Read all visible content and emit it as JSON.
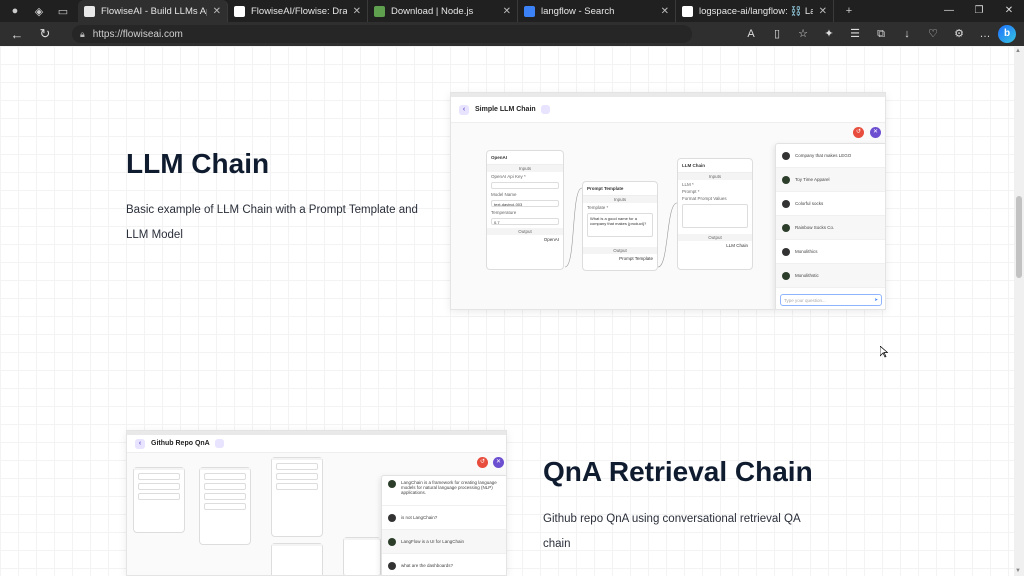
{
  "browser": {
    "tabs": [
      {
        "label": "FlowiseAI - Build LLMs Apps Easi",
        "active": true,
        "favicon_color": "#e8e8e8"
      },
      {
        "label": "FlowiseAI/Flowise: Drag & drop",
        "active": false,
        "favicon_color": "#ffffff"
      },
      {
        "label": "Download | Node.js",
        "active": false,
        "favicon_color": "#5fa04e"
      },
      {
        "label": "langflow - Search",
        "active": false,
        "favicon_color": "#3b82f6"
      },
      {
        "label": "logspace-ai/langflow: ⛓️ LangFl",
        "active": false,
        "favicon_color": "#ffffff"
      }
    ],
    "url": "https://flowiseai.com"
  },
  "section1": {
    "title": "LLM Chain",
    "description_line1": "Basic example of LLM Chain with a Prompt Template and",
    "description_line2": "LLM Model",
    "screenshot": {
      "header": "Simple LLM Chain",
      "node_openai": {
        "title": "OpenAI",
        "section": "Inputs",
        "field1": "OpenAI Api Key *",
        "field2": "Model Name",
        "field2_value": "text-davinci-003",
        "field3": "Temperature",
        "field3_value": "0.7",
        "output": "Output",
        "out_label": "OpenAI"
      },
      "node_prompt": {
        "title": "Prompt Template",
        "section": "Inputs",
        "field1": "Template *",
        "template": "What is a good name for a company that makes {product}?",
        "output": "Output",
        "out_label": "Prompt Template"
      },
      "node_llm": {
        "title": "LLM Chain",
        "section": "Inputs",
        "in1": "LLM *",
        "in2": "Prompt *",
        "field": "Format Prompt Values",
        "output": "Output",
        "out_label": "LLM Chain"
      },
      "chat_rows": [
        "Company that makes LEGO",
        "Toy Time Apparel",
        "Colorful socks",
        "Rainbow Socks Co.",
        "Monolithics",
        "Monolithstic"
      ],
      "chat_placeholder": "Type your question..."
    }
  },
  "section2": {
    "title": "QnA Retrieval Chain",
    "description_line1": "Github repo QnA using conversational retrieval QA",
    "description_line2": "chain",
    "screenshot": {
      "header": "Github Repo QnA",
      "chat_rows": [
        "LangChain is a framework for creating language models for natural language processing (NLP) applications.",
        "is not LangChain?",
        "LangFlow is a UI for LangChain",
        "what are the dashboards?"
      ]
    }
  }
}
